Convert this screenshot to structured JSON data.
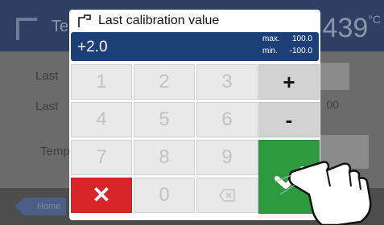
{
  "background": {
    "title": "Te",
    "temperature": "439",
    "temp_unit": "°C",
    "row1_label": "Last",
    "row2_label": "Last",
    "row3_label": "Temp",
    "row2_value": "00",
    "home_label": "Home"
  },
  "dialog": {
    "title": "Last calibration value",
    "icon": "calibration-icon",
    "display": {
      "value": "+2.0",
      "max_label": "max.",
      "max_value": "100.0",
      "min_label": "min.",
      "min_value": "-100.0"
    },
    "keys": {
      "k1": "1",
      "k2": "2",
      "k3": "3",
      "k4": "4",
      "k5": "5",
      "k6": "6",
      "k7": "7",
      "k8": "8",
      "k9": "9",
      "k0": "0",
      "plus": "+",
      "minus": "-",
      "cancel": "✕"
    }
  },
  "colors": {
    "display_bg": "#1c3f78",
    "confirm": "#2e9a3f",
    "cancel": "#d9252a",
    "header_bg": "#2e3f63"
  }
}
